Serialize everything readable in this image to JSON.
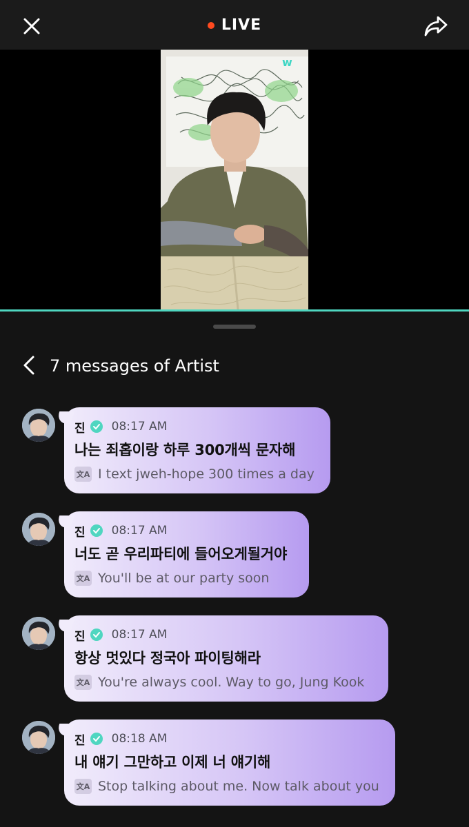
{
  "topbar": {
    "close_icon": "close-icon",
    "live_label": "LIVE",
    "live_dot_color": "#ff4a1f",
    "share_icon": "share-icon"
  },
  "video": {
    "watermark_icon": "weverse-logo-icon",
    "progress_color": "#4fd6c0"
  },
  "panel": {
    "title": "7 messages of Artist",
    "back_icon": "chevron-left-icon"
  },
  "messages": [
    {
      "name": "진",
      "time": "08:17 AM",
      "text": "나는 죄홉이랑 하루 300개씩 문자해",
      "translation": "I text jweh-hope 300 times a day"
    },
    {
      "name": "진",
      "time": "08:17 AM",
      "text": "너도 곧 우리파티에 들어오게될거야",
      "translation": "You'll be at our party soon"
    },
    {
      "name": "진",
      "time": "08:17 AM",
      "text": "항상 멋있다 정국아 파이팅해라",
      "translation": "You're always cool. Way to go, Jung Kook"
    },
    {
      "name": "진",
      "time": "08:18 AM",
      "text": "내 얘기 그만하고 이제 너 얘기해",
      "translation": "Stop talking about me. Now talk about you"
    }
  ]
}
